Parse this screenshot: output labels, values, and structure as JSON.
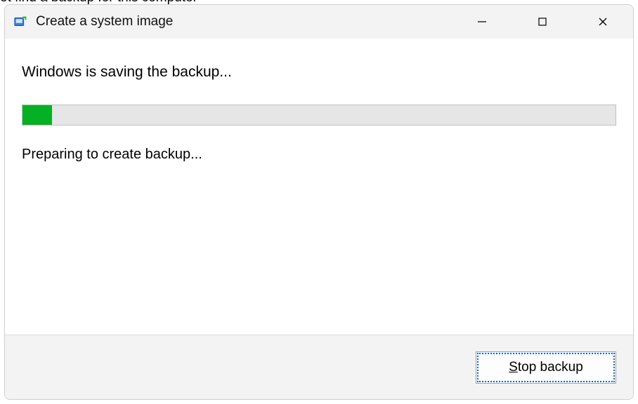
{
  "window": {
    "title": "Create a system image"
  },
  "body": {
    "heading": "Windows is saving the backup...",
    "status": "Preparing to create backup...",
    "progress_percent": 5
  },
  "footer": {
    "stop_button_prefix": "S",
    "stop_button_rest": "top backup"
  },
  "colors": {
    "progress_fill": "#06b025",
    "titlebar_bg": "#f3f3f3",
    "footer_bg": "#f3f3f3",
    "border": "#cfcfcf"
  }
}
